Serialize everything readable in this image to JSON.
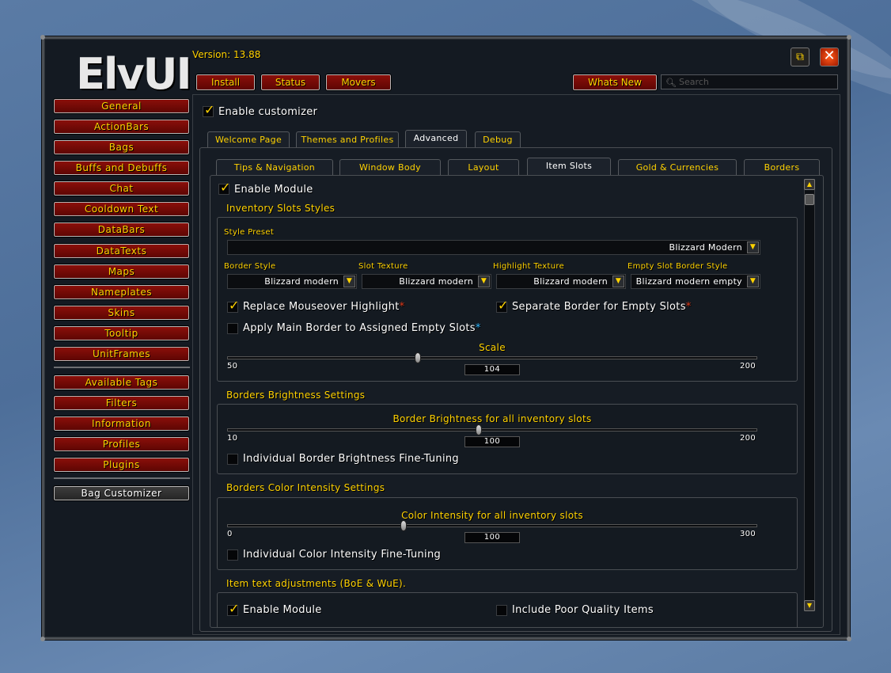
{
  "version": "Version: 13.88",
  "logo": "ElvUI",
  "nav": {
    "main": [
      "General",
      "ActionBars",
      "Bags",
      "Buffs and Debuffs",
      "Chat",
      "Cooldown Text",
      "DataBars",
      "DataTexts",
      "Maps",
      "Nameplates",
      "Skins",
      "Tooltip",
      "UnitFrames"
    ],
    "secondary": [
      "Available Tags",
      "Filters",
      "Information",
      "Profiles",
      "Plugins"
    ],
    "plugin": "Bag Customizer"
  },
  "top_buttons": {
    "install": "Install",
    "status": "Status",
    "movers": "Movers",
    "whats_new": "Whats New"
  },
  "search": {
    "placeholder": "Search"
  },
  "enable_customizer": "Enable customizer",
  "tabs_top": [
    "Welcome Page",
    "Themes and Profiles",
    "Advanced",
    "Debug"
  ],
  "tabs_sub": [
    "Tips & Navigation",
    "Window Body",
    "Layout",
    "Item Slots",
    "Gold & Currencies",
    "Borders"
  ],
  "enable_module": "Enable Module",
  "inventory": {
    "title": "Inventory Slots Styles",
    "style_preset_label": "Style Preset",
    "style_preset_value": "Blizzard Modern",
    "border_style_label": "Border Style",
    "border_style_value": "Blizzard modern",
    "slot_texture_label": "Slot Texture",
    "slot_texture_value": "Blizzard modern",
    "highlight_texture_label": "Highlight Texture",
    "highlight_texture_value": "Blizzard modern",
    "empty_slot_label": "Empty Slot Border Style",
    "empty_slot_value": "Blizzard modern empty",
    "replace_mouseover": "Replace Mouseover Highlight",
    "separate_border": "Separate Border for Empty Slots",
    "apply_main_border": "Apply Main Border to Assigned Empty Slots",
    "star": "*",
    "scale_label": "Scale",
    "scale_min": "50",
    "scale_max": "200",
    "scale_value": "104",
    "scale_fraction": 0.36
  },
  "brightness": {
    "title": "Borders Brightness Settings",
    "slider_label": "Border Brightness for all inventory slots",
    "min": "10",
    "max": "200",
    "value": "100",
    "fraction": 0.474,
    "fine_tune": "Individual Border Brightness Fine-Tuning"
  },
  "intensity": {
    "title": "Borders Color Intensity Settings",
    "slider_label": "Color Intensity for all inventory slots",
    "min": "0",
    "max": "300",
    "value": "100",
    "fraction": 0.333,
    "fine_tune": "Individual Color Intensity Fine-Tuning"
  },
  "item_text": {
    "title": "Item text adjustments (BoE & WuE).",
    "enable_module": "Enable Module",
    "include_poor": "Include Poor Quality Items"
  },
  "colors": {
    "gold": "#ffd200",
    "red_button": "#8a0f0a",
    "blue_star": "#2fb8ff"
  }
}
